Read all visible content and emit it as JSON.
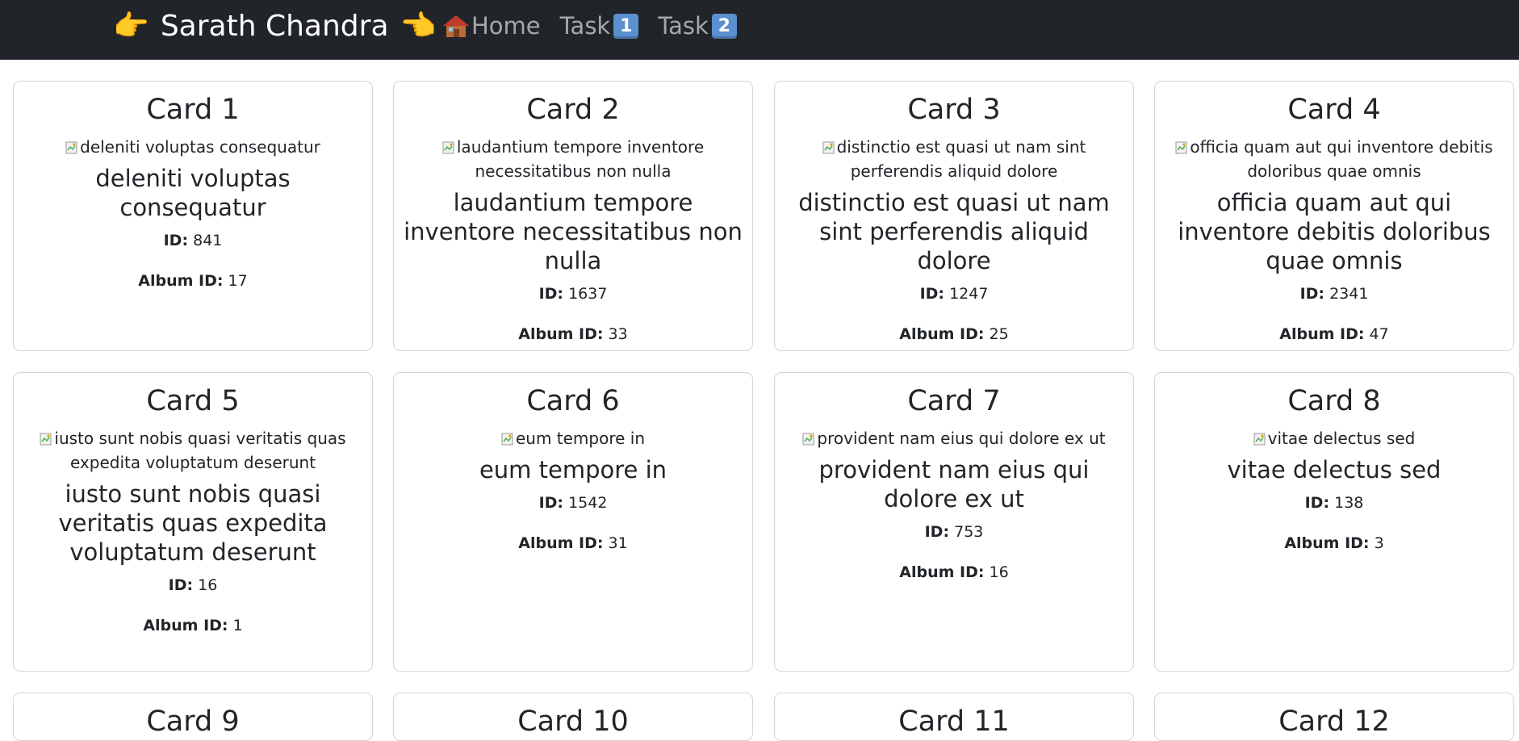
{
  "navbar": {
    "brand": "Sarath Chandra",
    "brand_left_emoji": "👉",
    "brand_right_emoji": "👈",
    "links": [
      {
        "label": "Home",
        "icon": "house-icon"
      },
      {
        "label": "Task",
        "badge": "1"
      },
      {
        "label": "Task",
        "badge": "2"
      }
    ]
  },
  "labels": {
    "id": "ID:",
    "album_id": "Album ID:"
  },
  "cards": [
    {
      "heading": "Card 1",
      "alt": "deleniti voluptas consequatur",
      "title": "deleniti voluptas consequatur",
      "id": "841",
      "album_id": "17"
    },
    {
      "heading": "Card 2",
      "alt": "laudantium tempore inventore necessitatibus non nulla",
      "title": "laudantium tempore inventore necessitatibus non nulla",
      "id": "1637",
      "album_id": "33"
    },
    {
      "heading": "Card 3",
      "alt": "distinctio est quasi ut nam sint perferendis aliquid dolore",
      "title": "distinctio est quasi ut nam sint perferendis aliquid dolore",
      "id": "1247",
      "album_id": "25"
    },
    {
      "heading": "Card 4",
      "alt": "officia quam aut qui inventore debitis doloribus quae omnis",
      "title": "officia quam aut qui inventore debitis doloribus quae omnis",
      "id": "2341",
      "album_id": "47"
    },
    {
      "heading": "Card 5",
      "alt": "iusto sunt nobis quasi veritatis quas expedita voluptatum deserunt",
      "title": "iusto sunt nobis quasi veritatis quas expedita voluptatum deserunt",
      "id": "16",
      "album_id": "1"
    },
    {
      "heading": "Card 6",
      "alt": "eum tempore in",
      "title": "eum tempore in",
      "id": "1542",
      "album_id": "31"
    },
    {
      "heading": "Card 7",
      "alt": "provident nam eius qui dolore ex ut",
      "title": "provident nam eius qui dolore ex ut",
      "id": "753",
      "album_id": "16"
    },
    {
      "heading": "Card 8",
      "alt": "vitae delectus sed",
      "title": "vitae delectus sed",
      "id": "138",
      "album_id": "3"
    },
    {
      "heading": "Card 9"
    },
    {
      "heading": "Card 10"
    },
    {
      "heading": "Card 11"
    },
    {
      "heading": "Card 12"
    }
  ]
}
